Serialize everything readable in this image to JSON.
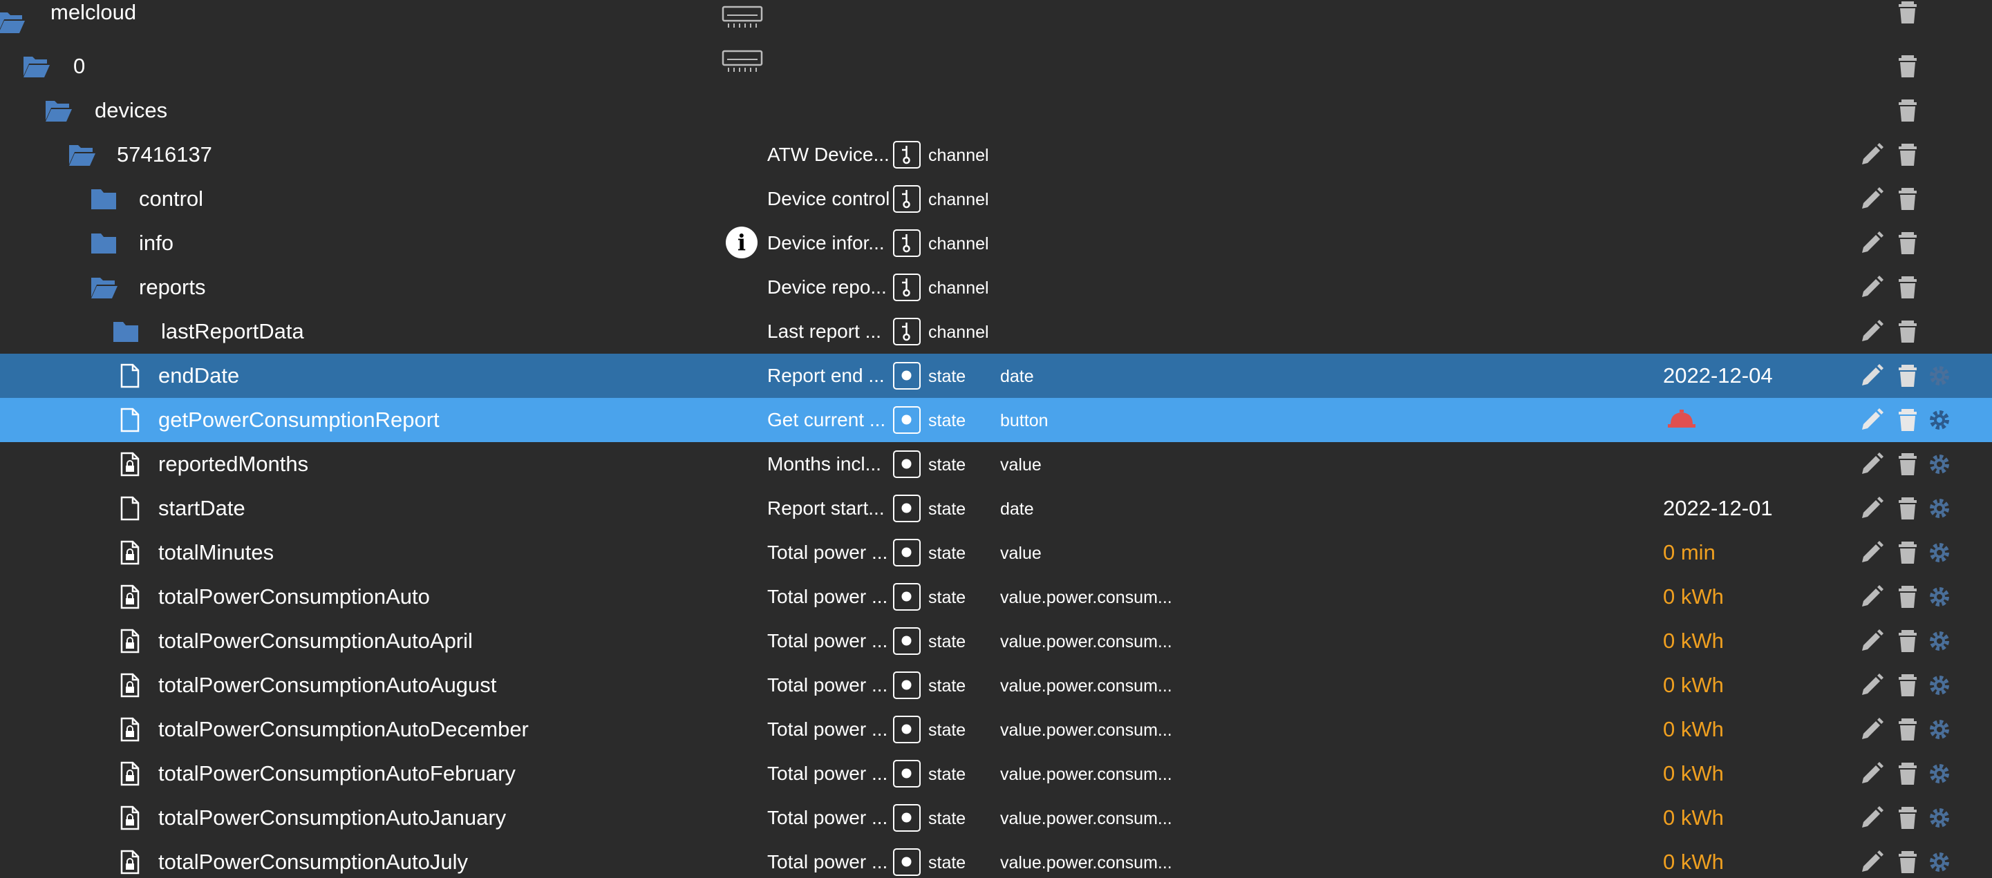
{
  "colors": {
    "background": "#2b2b2b",
    "selected_row": "#2f6fa6",
    "hover_row": "#4aa3ec",
    "folder": "#4a7fc0",
    "value_orange": "#f0a020",
    "alarm_red": "#e05050"
  },
  "rows": [
    {
      "name": "melcloud",
      "icon": "folder-open-icon",
      "desc": "",
      "type": "",
      "role": "",
      "value": "",
      "extra": "device-icon"
    },
    {
      "name": "0",
      "icon": "folder-open-icon",
      "desc": "",
      "type": "",
      "role": "",
      "value": "",
      "extra": "device-icon"
    },
    {
      "name": "devices",
      "icon": "folder-open-icon",
      "desc": "",
      "type": "",
      "role": "",
      "value": ""
    },
    {
      "name": "57416137",
      "icon": "folder-open-icon",
      "desc": "ATW Device...",
      "type": "channel",
      "role": "",
      "value": ""
    },
    {
      "name": "control",
      "icon": "folder-icon",
      "desc": "Device control",
      "type": "channel",
      "role": "",
      "value": ""
    },
    {
      "name": "info",
      "icon": "folder-icon",
      "desc": "Device infor...",
      "type": "channel",
      "role": "",
      "value": "",
      "extra": "info-icon"
    },
    {
      "name": "reports",
      "icon": "folder-open-icon",
      "desc": "Device repo...",
      "type": "channel",
      "role": "",
      "value": ""
    },
    {
      "name": "lastReportData",
      "icon": "folder-icon",
      "desc": "Last report ...",
      "type": "channel",
      "role": "",
      "value": ""
    },
    {
      "name": "endDate",
      "icon": "file-icon",
      "desc": "Report end ...",
      "type": "state",
      "role": "date",
      "value": "2022-12-04"
    },
    {
      "name": "getPowerConsumptionReport",
      "icon": "file-icon",
      "desc": "Get current ...",
      "type": "state",
      "role": "button",
      "value": ""
    },
    {
      "name": "reportedMonths",
      "icon": "file-lock-icon",
      "desc": "Months incl...",
      "type": "state",
      "role": "value",
      "value": ""
    },
    {
      "name": "startDate",
      "icon": "file-icon",
      "desc": "Report start...",
      "type": "state",
      "role": "date",
      "value": "2022-12-01"
    },
    {
      "name": "totalMinutes",
      "icon": "file-lock-icon",
      "desc": "Total power ...",
      "type": "state",
      "role": "value",
      "value": "0 min"
    },
    {
      "name": "totalPowerConsumptionAuto",
      "icon": "file-lock-icon",
      "desc": "Total power ...",
      "type": "state",
      "role": "value.power.consum...",
      "value": "0 kWh"
    },
    {
      "name": "totalPowerConsumptionAutoApril",
      "icon": "file-lock-icon",
      "desc": "Total power ...",
      "type": "state",
      "role": "value.power.consum...",
      "value": "0 kWh"
    },
    {
      "name": "totalPowerConsumptionAutoAugust",
      "icon": "file-lock-icon",
      "desc": "Total power ...",
      "type": "state",
      "role": "value.power.consum...",
      "value": "0 kWh"
    },
    {
      "name": "totalPowerConsumptionAutoDecember",
      "icon": "file-lock-icon",
      "desc": "Total power ...",
      "type": "state",
      "role": "value.power.consum...",
      "value": "0 kWh"
    },
    {
      "name": "totalPowerConsumptionAutoFebruary",
      "icon": "file-lock-icon",
      "desc": "Total power ...",
      "type": "state",
      "role": "value.power.consum...",
      "value": "0 kWh"
    },
    {
      "name": "totalPowerConsumptionAutoJanuary",
      "icon": "file-lock-icon",
      "desc": "Total power ...",
      "type": "state",
      "role": "value.power.consum...",
      "value": "0 kWh"
    },
    {
      "name": "totalPowerConsumptionAutoJuly",
      "icon": "file-lock-icon",
      "desc": "Total power ...",
      "type": "state",
      "role": "value.power.consum...",
      "value": "0 kWh"
    }
  ]
}
